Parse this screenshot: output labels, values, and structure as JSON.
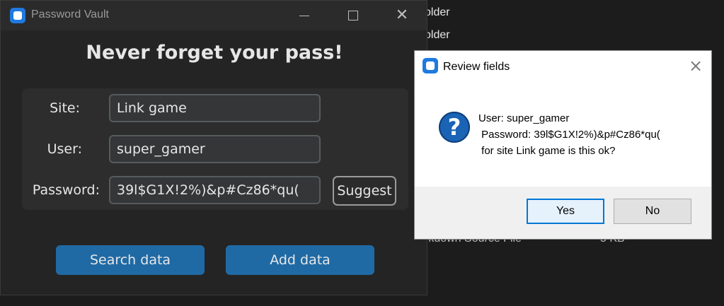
{
  "background": {
    "folder_row_1": "older",
    "folder_row_2": "older",
    "file_row_type": "rkdown Source File",
    "file_row_size": "5 KB"
  },
  "vault_window": {
    "title": "Password Vault",
    "heading": "Never forget your pass!",
    "site_label": "Site:",
    "site_value": "Link game",
    "user_label": "User:",
    "user_value": "super_gamer",
    "password_label": "Password:",
    "password_value": "39l$G1X!2%)&p#Cz86*qu(",
    "suggest_label": "Suggest",
    "search_label": "Search data",
    "add_label": "Add data"
  },
  "dialog": {
    "title": "Review fields",
    "close_glyph": "×",
    "icon_glyph": "?",
    "message_line_1": "User: super_gamer",
    "message_line_2": " Password: 39l$G1X!2%)&p#Cz86*qu(",
    "message_line_3": " for site Link game is this ok?",
    "yes_label": "Yes",
    "no_label": "No"
  },
  "colors": {
    "accent_blue": "#1f6aa5",
    "app_icon_blue": "#1f7ae0",
    "dialog_default_border": "#0078d7"
  },
  "icons": {
    "app_icon": "app-square-icon",
    "dialog_icon": "question-icon"
  }
}
